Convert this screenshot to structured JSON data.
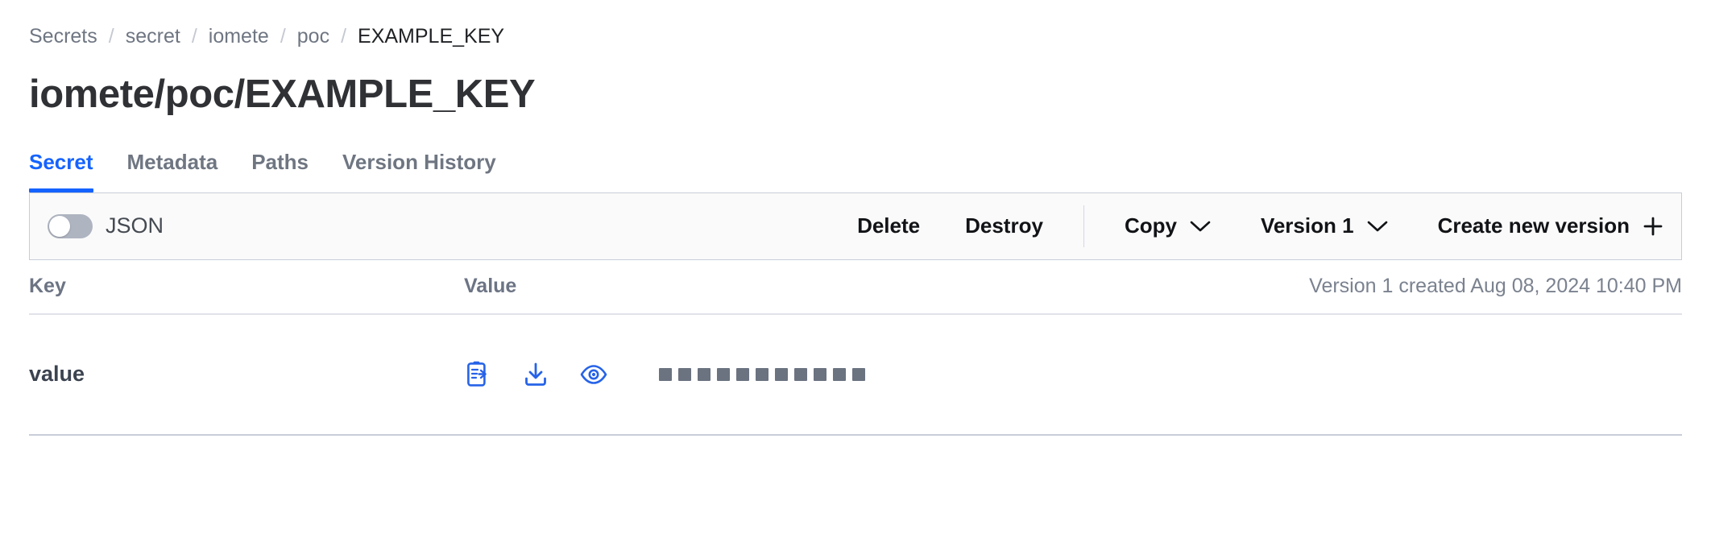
{
  "breadcrumb": {
    "separator": "/",
    "items": [
      {
        "label": "Secrets",
        "current": false
      },
      {
        "label": "secret",
        "current": false
      },
      {
        "label": "iomete",
        "current": false
      },
      {
        "label": "poc",
        "current": false
      },
      {
        "label": "EXAMPLE_KEY",
        "current": true
      }
    ]
  },
  "page": {
    "title": "iomete/poc/EXAMPLE_KEY"
  },
  "tabs": [
    {
      "label": "Secret",
      "active": true
    },
    {
      "label": "Metadata",
      "active": false
    },
    {
      "label": "Paths",
      "active": false
    },
    {
      "label": "Version History",
      "active": false
    }
  ],
  "toolbar": {
    "json_toggle": {
      "label": "JSON",
      "enabled": false
    },
    "delete_label": "Delete",
    "destroy_label": "Destroy",
    "copy_label": "Copy",
    "version_label": "Version 1",
    "create_version_label": "Create new version",
    "chevron_icon": "chevron-down-icon",
    "plus_icon": "plus-icon"
  },
  "table": {
    "headers": {
      "key": "Key",
      "value": "Value"
    },
    "version_info": "Version 1 created Aug 08, 2024 10:40 PM",
    "rows": [
      {
        "key": "value",
        "masked_value_length": 11,
        "actions": [
          {
            "icon": "copy-to-clipboard-icon",
            "label": "Copy"
          },
          {
            "icon": "download-icon",
            "label": "Download"
          },
          {
            "icon": "eye-icon",
            "label": "Reveal"
          }
        ]
      }
    ]
  },
  "colors": {
    "accent": "#1563ff",
    "icon_blue": "#2663e8",
    "text_primary": "#1f2124",
    "text_muted": "#6f7682",
    "toolbar_bg": "#fafafa",
    "border": "#c8cdd8",
    "mask_dot": "#6b7280"
  }
}
